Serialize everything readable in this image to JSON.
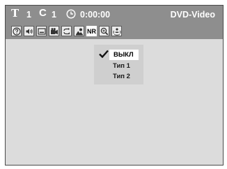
{
  "status_bar": {
    "title_letter": "T",
    "title_number": "1",
    "chapter_letter": "C",
    "chapter_number": "1",
    "time": "0:00:00",
    "disc_type": "DVD-Video"
  },
  "icon_row": {
    "icons": [
      "help-icon",
      "audio-icon",
      "subtitle-icon",
      "angle-icon",
      "repeat-icon",
      "picture-icon",
      "nr-icon",
      "zoom-icon",
      "surround-icon"
    ],
    "nr_label": "NR"
  },
  "nr_menu": {
    "items": [
      {
        "label": "ВЫКЛ",
        "selected": true
      },
      {
        "label": "Тип 1",
        "selected": false
      },
      {
        "label": "Тип 2",
        "selected": false
      }
    ]
  },
  "colors": {
    "bar": "#8e8e8e",
    "screen": "#dcdcdc",
    "menu": "#cfcfcf",
    "highlight": "#ffffff"
  }
}
